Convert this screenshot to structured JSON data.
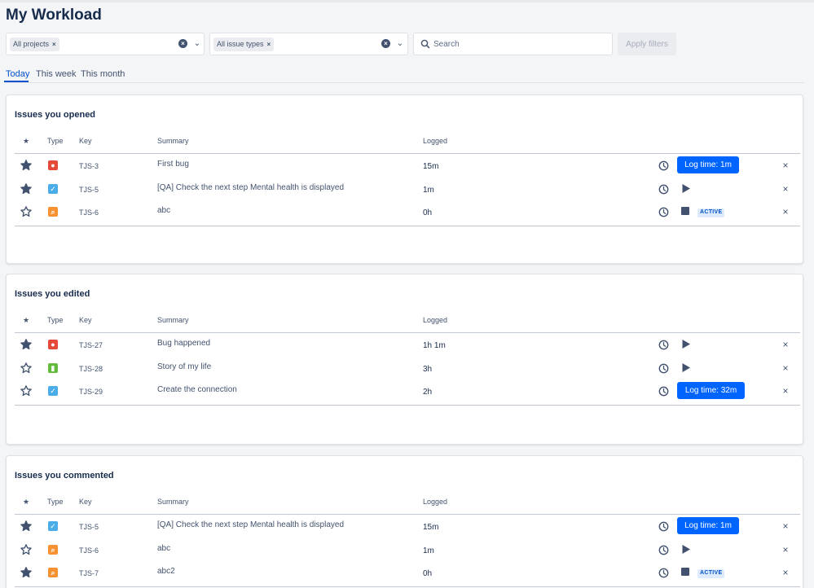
{
  "header": {
    "title": "My Workload"
  },
  "filters": {
    "projects_chip": "All projects",
    "issue_types_chip": "All issue types",
    "search_placeholder": "Search",
    "apply_label": "Apply filters"
  },
  "tabs": [
    {
      "label": "Today",
      "active": true
    },
    {
      "label": "This week",
      "active": false
    },
    {
      "label": "This month",
      "active": false
    }
  ],
  "columns": {
    "type": "Type",
    "key": "Key",
    "summary": "Summary",
    "logged": "Logged"
  },
  "badges": {
    "active": "ACTIVE"
  },
  "colors": {
    "accent": "#0065ff",
    "bug": "#e5493a",
    "task": "#4bade8",
    "story": "#63ba3c",
    "improvement": "#f79232"
  },
  "sections": [
    {
      "title": "Issues you opened",
      "rows": [
        {
          "starred": true,
          "type": "bug",
          "key": "TJS-3",
          "summary": "First bug",
          "logged": "15m",
          "action": "log",
          "log_label": "Log time: 1m"
        },
        {
          "starred": true,
          "type": "task",
          "key": "TJS-5",
          "summary": "[QA] Check the next step Mental health is displayed",
          "logged": "1m",
          "action": "play"
        },
        {
          "starred": false,
          "type": "improvement",
          "key": "TJS-6",
          "summary": "abc",
          "logged": "0h",
          "action": "active"
        }
      ]
    },
    {
      "title": "Issues you edited",
      "rows": [
        {
          "starred": true,
          "type": "bug",
          "key": "TJS-27",
          "summary": "Bug happened",
          "logged": "1h 1m",
          "action": "play"
        },
        {
          "starred": false,
          "type": "story",
          "key": "TJS-28",
          "summary": "Story of my life",
          "logged": "3h",
          "action": "play"
        },
        {
          "starred": false,
          "type": "task",
          "key": "TJS-29",
          "summary": "Create the connection",
          "logged": "2h",
          "action": "log",
          "log_label": "Log time: 32m"
        }
      ]
    },
    {
      "title": "Issues you commented",
      "rows": [
        {
          "starred": true,
          "type": "task",
          "key": "TJS-5",
          "summary": "[QA] Check the next step Mental health is displayed",
          "logged": "15m",
          "action": "log",
          "log_label": "Log time: 1m"
        },
        {
          "starred": false,
          "type": "improvement",
          "key": "TJS-6",
          "summary": "abc",
          "logged": "1m",
          "action": "play"
        },
        {
          "starred": true,
          "type": "improvement",
          "key": "TJS-7",
          "summary": "abc2",
          "logged": "0h",
          "action": "active"
        }
      ]
    }
  ]
}
